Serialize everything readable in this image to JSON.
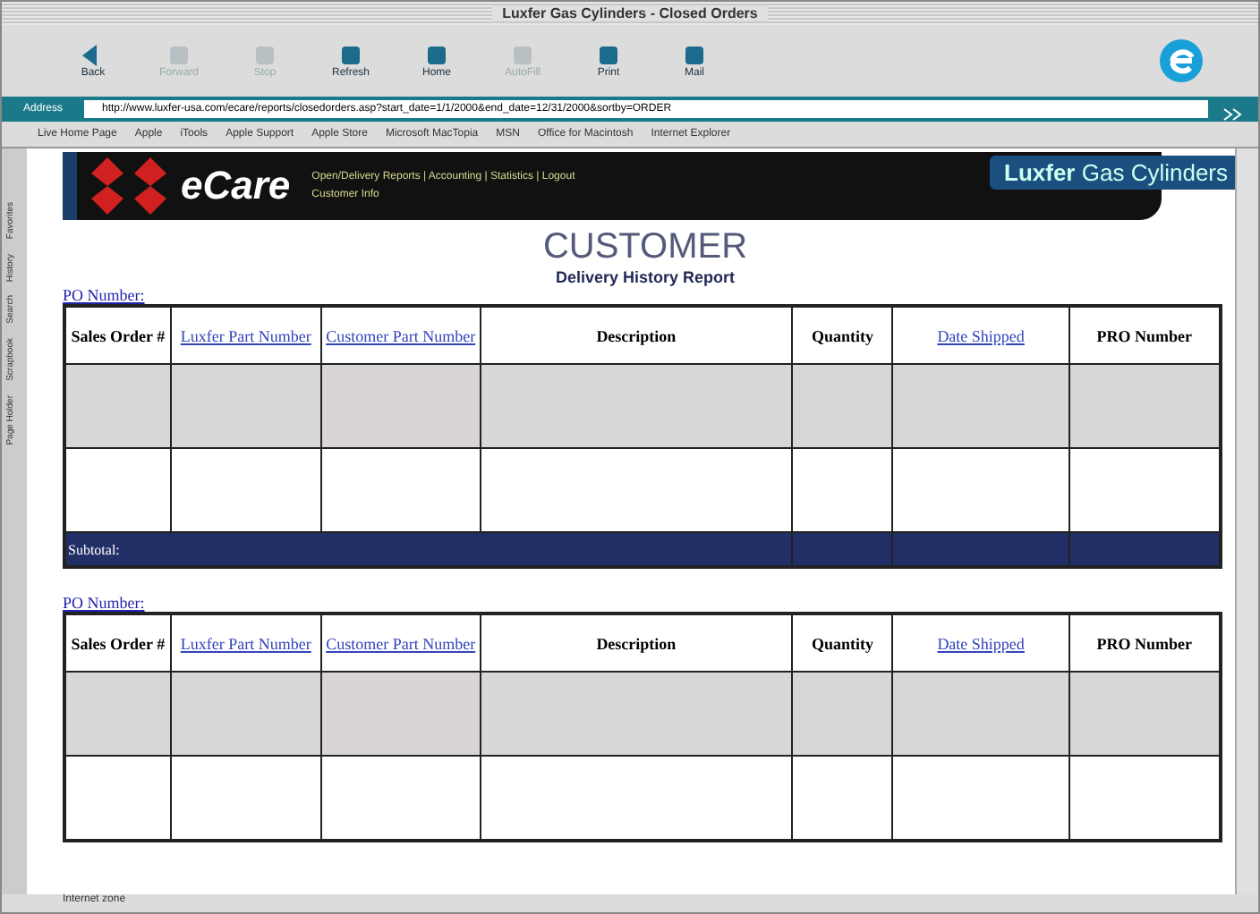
{
  "window": {
    "title": "Luxfer Gas Cylinders - Closed Orders"
  },
  "toolbar": [
    {
      "label": "Back",
      "disabled": false,
      "kind": "back"
    },
    {
      "label": "Forward",
      "disabled": true,
      "kind": "forward"
    },
    {
      "label": "Stop",
      "disabled": true,
      "kind": "stop"
    },
    {
      "label": "Refresh",
      "disabled": false,
      "kind": "refresh"
    },
    {
      "label": "Home",
      "disabled": false,
      "kind": "home"
    },
    {
      "label": "AutoFill",
      "disabled": true,
      "kind": "autofill"
    },
    {
      "label": "Print",
      "disabled": false,
      "kind": "print"
    },
    {
      "label": "Mail",
      "disabled": false,
      "kind": "mail"
    }
  ],
  "address": {
    "label": "Address",
    "value": "http://www.luxfer-usa.com/ecare/reports/closedorders.asp?start_date=1/1/2000&end_date=12/31/2000&sortby=ORDER"
  },
  "favorites": [
    "Live Home Page",
    "Apple",
    "iTools",
    "Apple Support",
    "Apple Store",
    "Microsoft MacTopia",
    "MSN",
    "Office for Macintosh",
    "Internet Explorer"
  ],
  "side_tabs": [
    "Favorites",
    "History",
    "Search",
    "Scrapbook",
    "Page Holder"
  ],
  "banner": {
    "logo": "eCare",
    "nav": "Open/Delivery Reports | Accounting | Statistics | Logout",
    "nav_2": "Customer Info",
    "brand": "Luxfer",
    "brand_2": "Gas Cylinders"
  },
  "heading": {
    "title": "CUSTOMER",
    "subtitle": "Delivery History Report"
  },
  "sections": [
    {
      "po_label": "PO Number:",
      "columns": [
        {
          "label": "Sales Order #",
          "link": false
        },
        {
          "label": "Luxfer Part Number",
          "link": true
        },
        {
          "label": "Customer Part Number",
          "link": true
        },
        {
          "label": "Description",
          "link": false
        },
        {
          "label": "Quantity",
          "link": false
        },
        {
          "label": "Date Shipped",
          "link": true
        },
        {
          "label": "PRO Number",
          "link": false
        }
      ],
      "rows": [
        {
          "shaded": true
        },
        {
          "shaded": false
        }
      ],
      "subtotal": "Subtotal:"
    },
    {
      "po_label": "PO Number:",
      "columns": [
        {
          "label": "Sales Order #",
          "link": false
        },
        {
          "label": "Luxfer Part Number",
          "link": true
        },
        {
          "label": "Customer Part Number",
          "link": true
        },
        {
          "label": "Description",
          "link": false
        },
        {
          "label": "Quantity",
          "link": false
        },
        {
          "label": "Date Shipped",
          "link": true
        },
        {
          "label": "PRO Number",
          "link": false
        }
      ],
      "rows": [
        {
          "shaded": true
        },
        {
          "shaded": false
        }
      ]
    }
  ],
  "status_bar": {
    "zone": "Internet zone"
  }
}
